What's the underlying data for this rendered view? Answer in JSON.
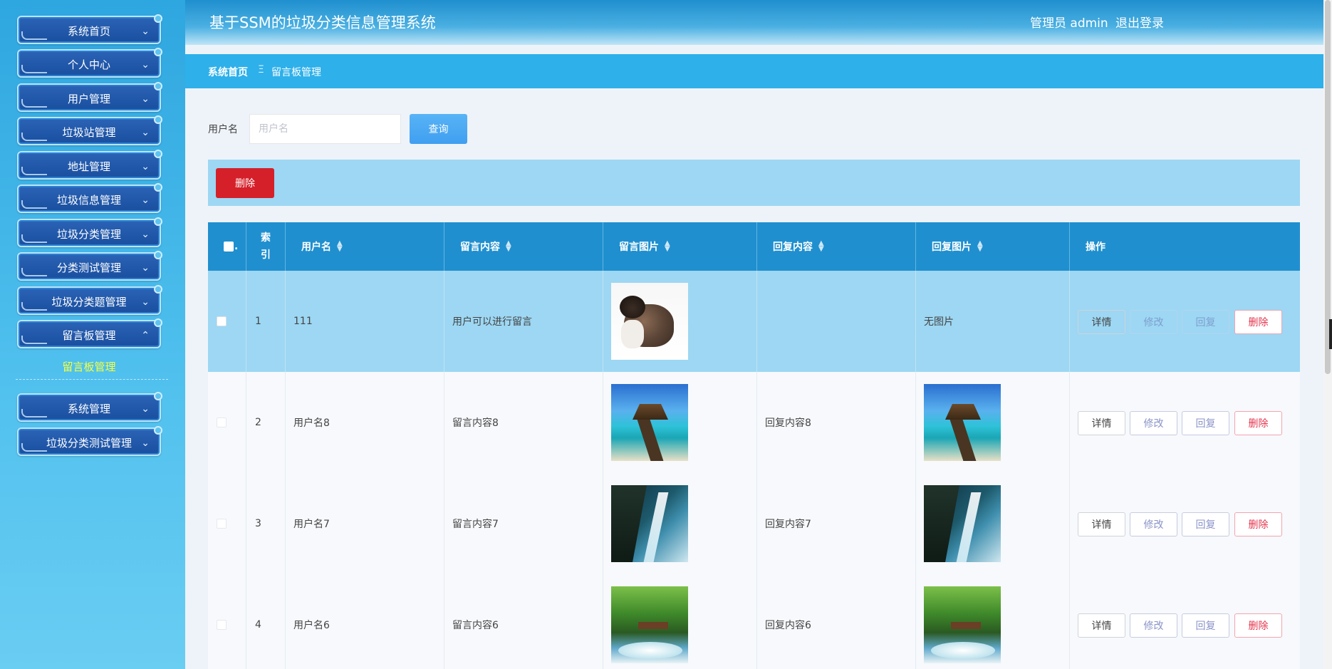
{
  "sidebar": {
    "items": [
      {
        "label": "系统首页"
      },
      {
        "label": "个人中心"
      },
      {
        "label": "用户管理"
      },
      {
        "label": "垃圾站管理"
      },
      {
        "label": "地址管理"
      },
      {
        "label": "垃圾信息管理"
      },
      {
        "label": "垃圾分类管理"
      },
      {
        "label": "分类测试管理"
      },
      {
        "label": "垃圾分类题管理"
      },
      {
        "label": "留言板管理"
      },
      {
        "label": "系统管理"
      },
      {
        "label": "垃圾分类测试管理"
      }
    ],
    "submenu_active": "留言板管理",
    "chevron_icon": "chevron-down-icon"
  },
  "header": {
    "title": "基于SSM的垃圾分类信息管理系统",
    "user": "管理员 admin",
    "logout": "退出登录"
  },
  "breadcrumb": {
    "home": "系统首页",
    "separator": "Ξ",
    "current": "留言板管理"
  },
  "search": {
    "label": "用户名",
    "placeholder": "用户名",
    "value": "",
    "button": "查询"
  },
  "actions": {
    "bulk_delete": "删除"
  },
  "table": {
    "headers": {
      "index_line1": "索",
      "index_line2": "引",
      "username": "用户名",
      "content": "留言内容",
      "image": "留言图片",
      "reply": "回复内容",
      "reply_image": "回复图片",
      "ops": "操作"
    },
    "rows": [
      {
        "index": "1",
        "username": "111",
        "content": "用户可以进行留言",
        "image": "cat",
        "reply": "",
        "reply_image_text": "无图片",
        "reply_image": ""
      },
      {
        "index": "2",
        "username": "用户名8",
        "content": "留言内容8",
        "image": "beach",
        "reply": "回复内容8",
        "reply_image_text": "",
        "reply_image": "beach"
      },
      {
        "index": "3",
        "username": "用户名7",
        "content": "留言内容7",
        "image": "falls",
        "reply": "回复内容7",
        "reply_image_text": "",
        "reply_image": "falls"
      },
      {
        "index": "4",
        "username": "用户名6",
        "content": "留言内容6",
        "image": "forest",
        "reply": "回复内容6",
        "reply_image_text": "",
        "reply_image": "forest"
      }
    ],
    "op_labels": {
      "detail": "详情",
      "edit": "修改",
      "reply": "回复",
      "delete": "删除"
    }
  },
  "colors": {
    "header": "#1f8fcf",
    "breadcrumb": "#2eb0ea",
    "selected_row": "#9dd7f3",
    "delete_button": "#d5202a",
    "search_button": "#3f9ff0",
    "submenu_active": "#f6ff3c"
  }
}
